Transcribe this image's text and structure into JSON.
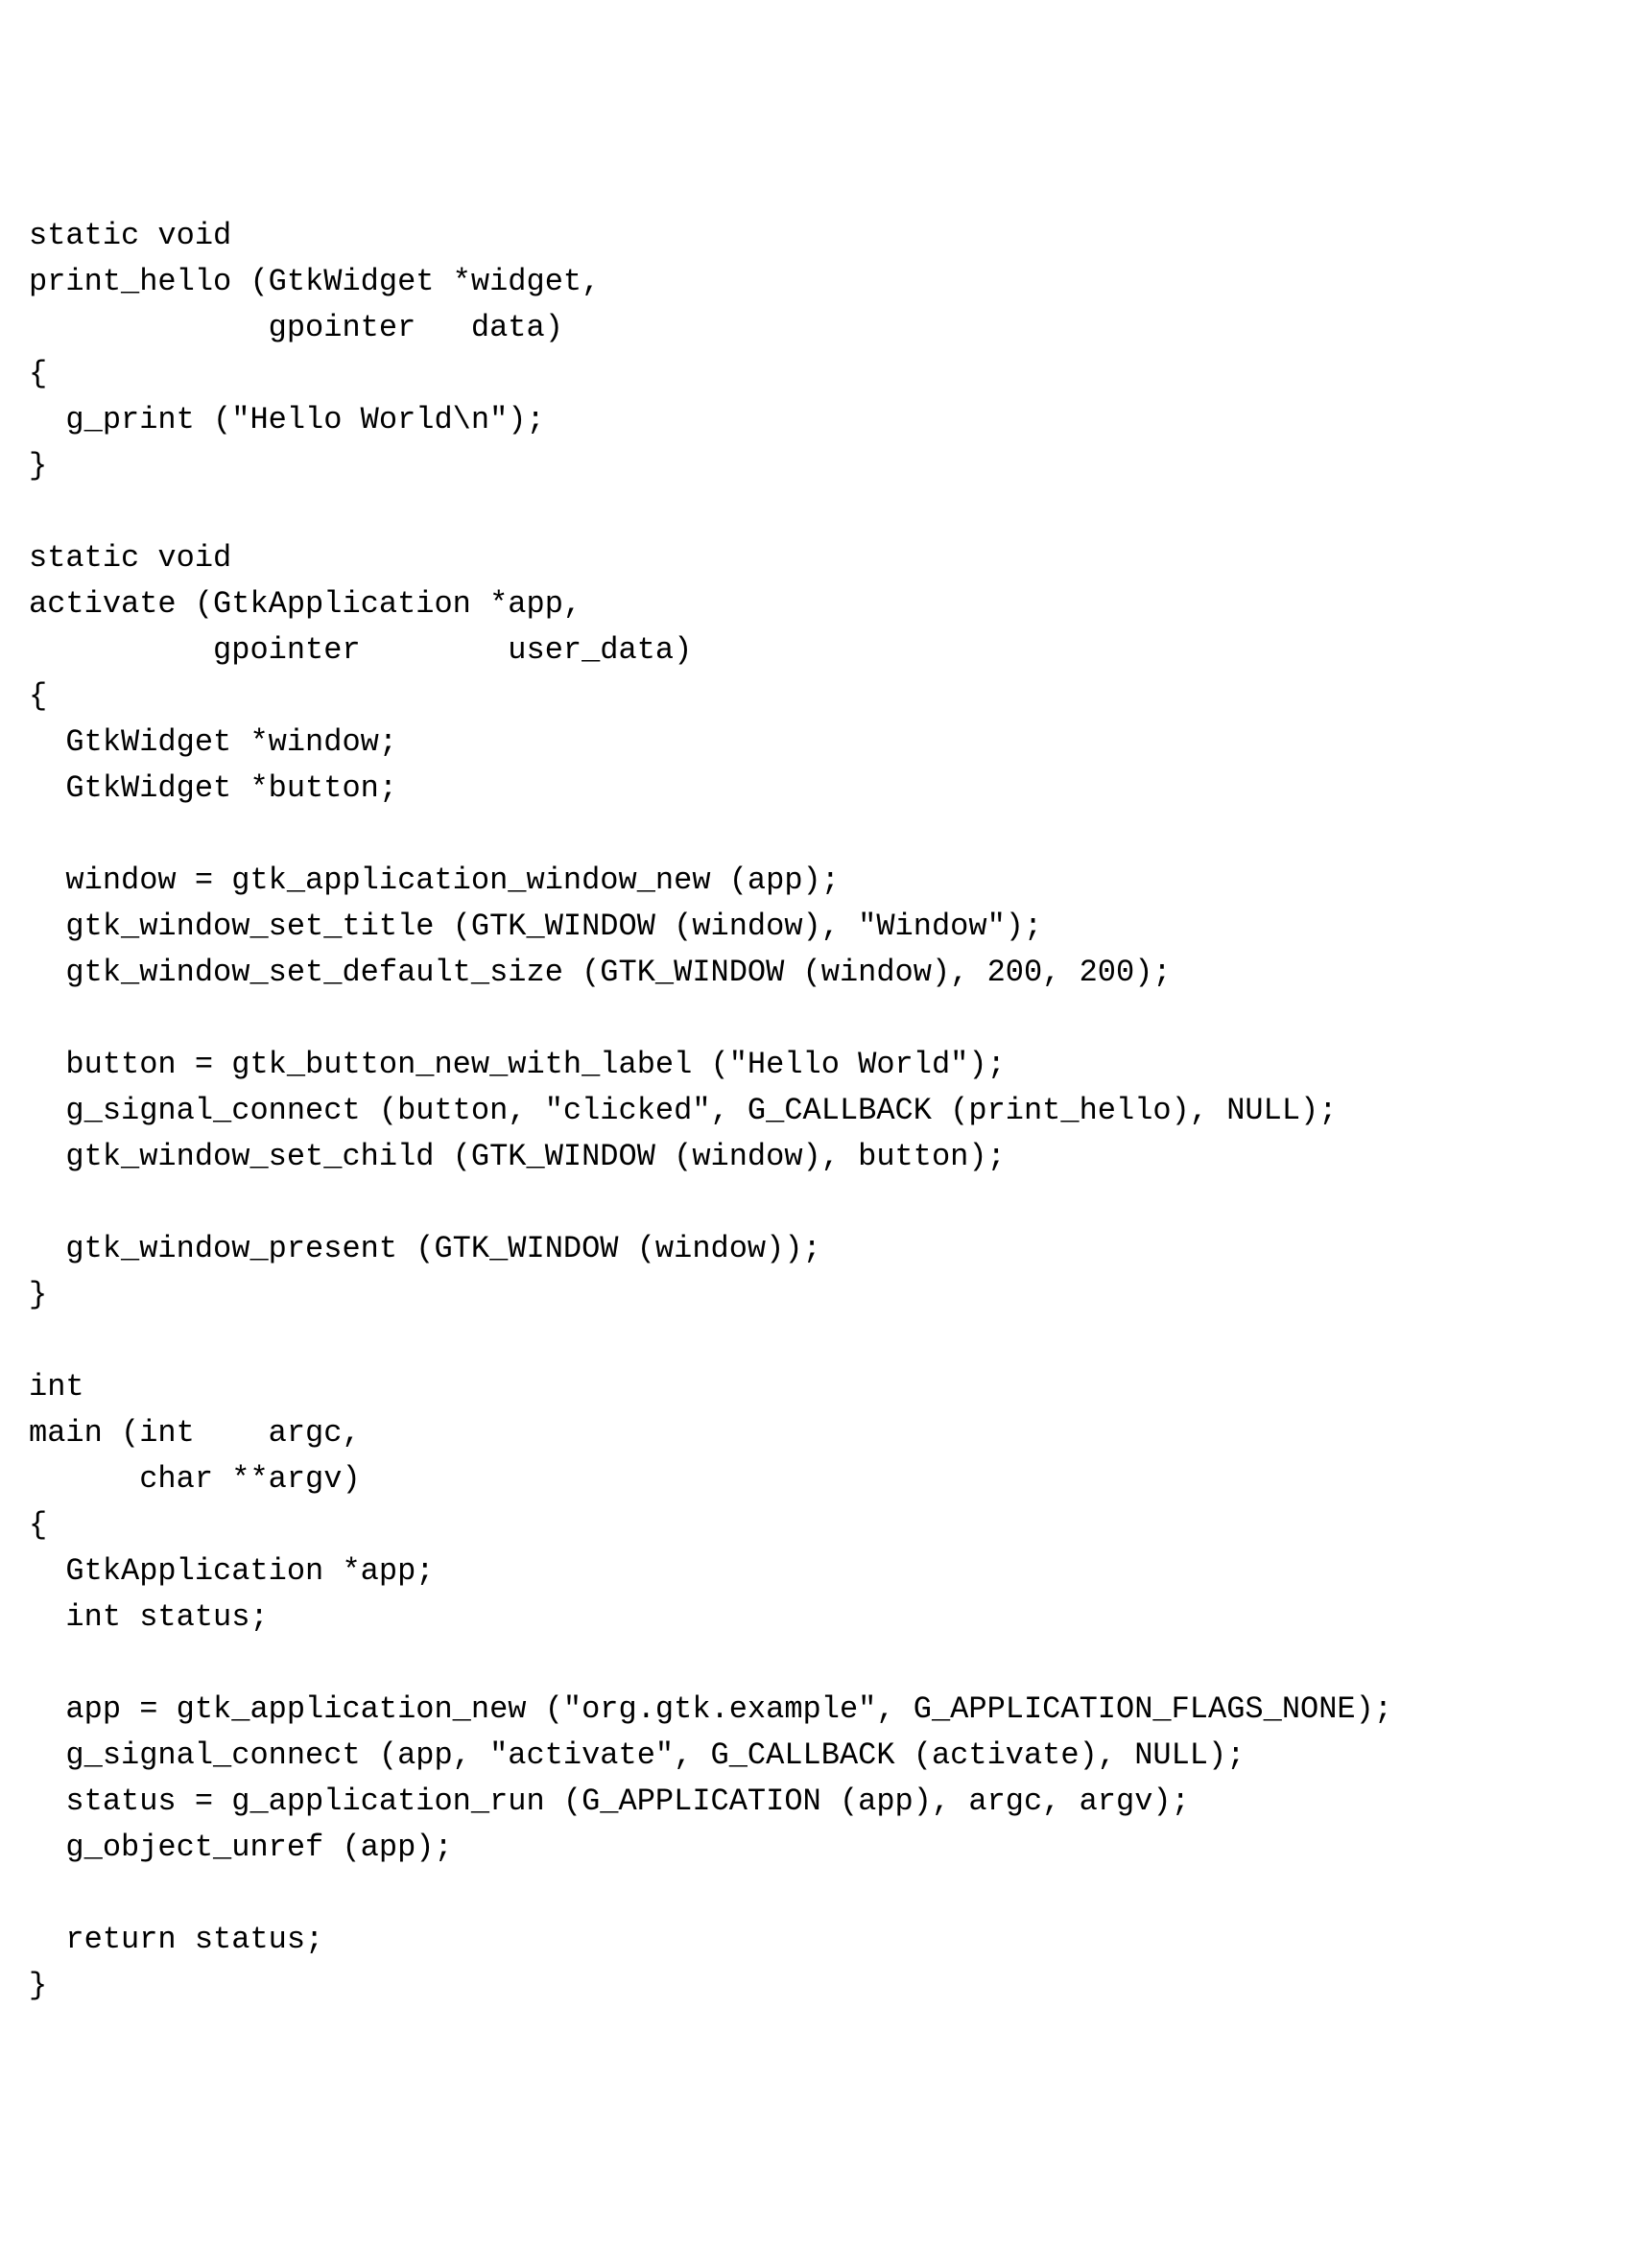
{
  "code": "static void\nprint_hello (GtkWidget *widget,\n             gpointer   data)\n{\n  g_print (\"Hello World\\n\");\n}\n\nstatic void\nactivate (GtkApplication *app,\n          gpointer        user_data)\n{\n  GtkWidget *window;\n  GtkWidget *button;\n\n  window = gtk_application_window_new (app);\n  gtk_window_set_title (GTK_WINDOW (window), \"Window\");\n  gtk_window_set_default_size (GTK_WINDOW (window), 200, 200);\n\n  button = gtk_button_new_with_label (\"Hello World\");\n  g_signal_connect (button, \"clicked\", G_CALLBACK (print_hello), NULL);\n  gtk_window_set_child (GTK_WINDOW (window), button);\n\n  gtk_window_present (GTK_WINDOW (window));\n}\n\nint\nmain (int    argc,\n      char **argv)\n{\n  GtkApplication *app;\n  int status;\n\n  app = gtk_application_new (\"org.gtk.example\", G_APPLICATION_FLAGS_NONE);\n  g_signal_connect (app, \"activate\", G_CALLBACK (activate), NULL);\n  status = g_application_run (G_APPLICATION (app), argc, argv);\n  g_object_unref (app);\n\n  return status;\n}"
}
